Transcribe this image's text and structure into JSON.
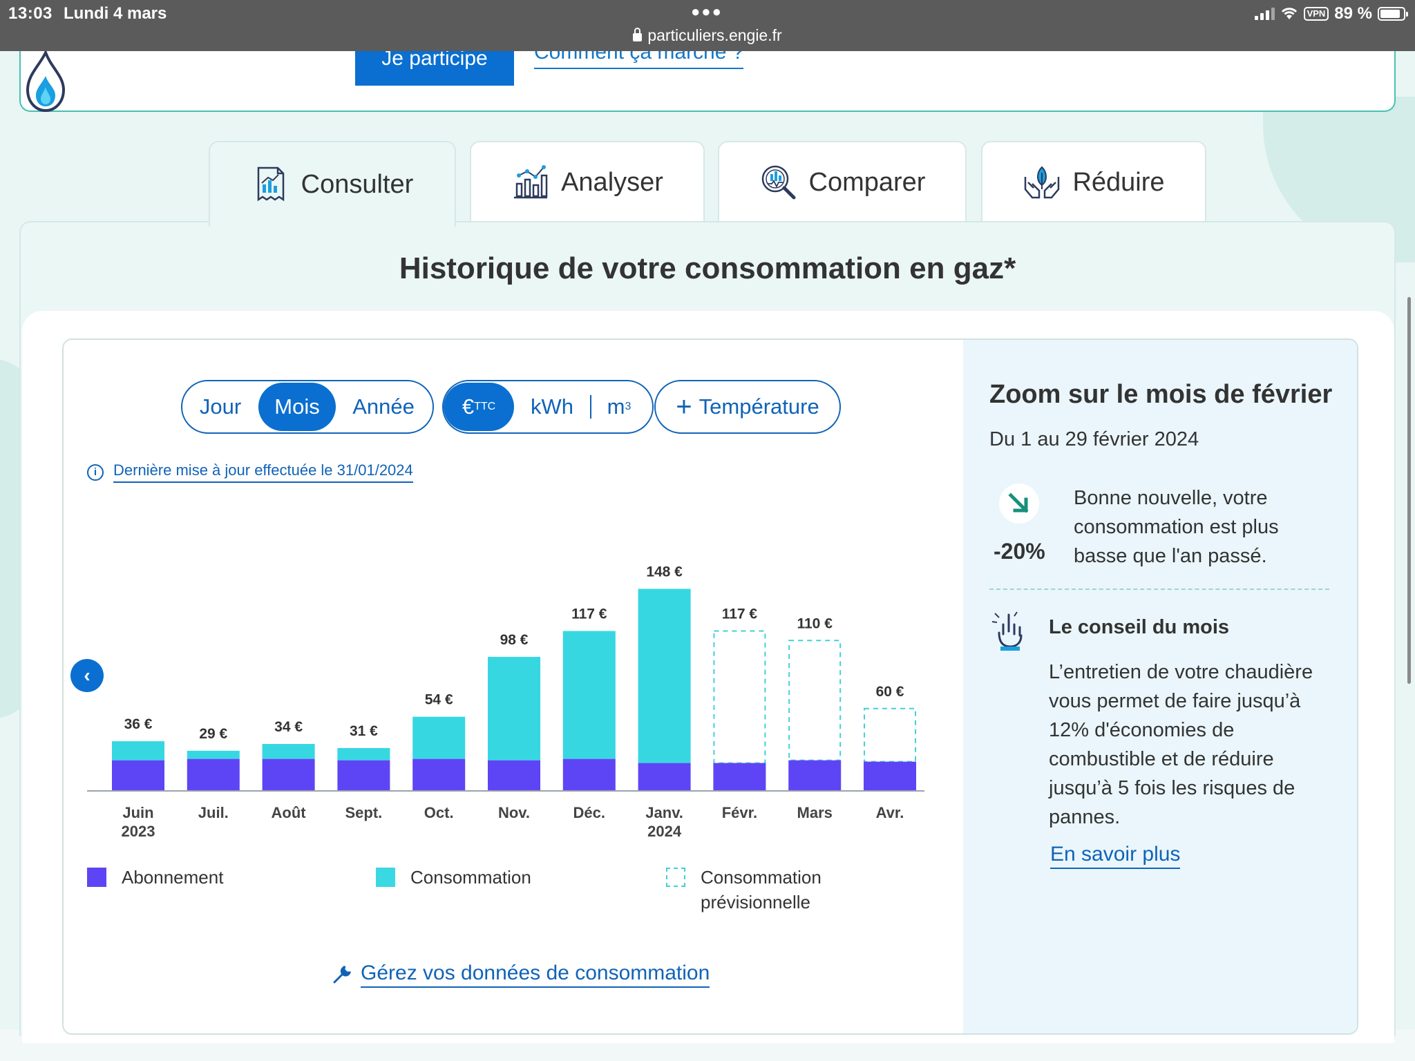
{
  "status_bar": {
    "time": "13:03",
    "date": "Lundi 4 mars",
    "url": "particuliers.engie.fr",
    "vpn": "VPN",
    "battery": "89 %"
  },
  "top": {
    "participe_label": "Je participe",
    "comment_label": "Comment ça marche ?"
  },
  "tabs": [
    {
      "label": "Consulter",
      "icon": "document-chart-icon"
    },
    {
      "label": "Analyser",
      "icon": "bar-trend-icon"
    },
    {
      "label": "Comparer",
      "icon": "magnifier-chart-icon"
    },
    {
      "label": "Réduire",
      "icon": "hands-leaf-icon"
    }
  ],
  "title": "Historique de votre consommation en gaz*",
  "controls": {
    "period": [
      "Jour",
      "Mois",
      "Année"
    ],
    "period_selected": "Mois",
    "unit_euro": "€",
    "unit_euro_sup": "TTC",
    "unit_kwh": "kWh",
    "unit_m3": "m",
    "unit_m3_sup": "3",
    "unit_selected": "€TTC",
    "temperature": "Température"
  },
  "update_text": "Dernière mise à jour effectuée le 31/01/2024",
  "chart_data": {
    "type": "bar",
    "stacked": true,
    "categories": [
      "Juin",
      "Juil.",
      "Août",
      "Sept.",
      "Oct.",
      "Nov.",
      "Déc.",
      "Janv.",
      "Févr.",
      "Mars",
      "Avr."
    ],
    "year_labels": [
      "2023",
      "",
      "",
      "",
      "",
      "",
      "",
      "2024",
      "",
      "",
      ""
    ],
    "value_labels": [
      "36 €",
      "29 €",
      "34 €",
      "31 €",
      "54 €",
      "98 €",
      "117 €",
      "148 €",
      "117 €",
      "110 €",
      "60 €"
    ],
    "totals": [
      36,
      29,
      34,
      31,
      54,
      98,
      117,
      148,
      117,
      110,
      60
    ],
    "series": [
      {
        "name": "Abonnement",
        "color": "#5d45f5",
        "values": [
          22,
          23,
          23,
          22,
          23,
          22,
          23,
          20,
          20,
          22,
          21
        ]
      },
      {
        "name": "Consommation",
        "color": "#37d7e2",
        "values": [
          14,
          6,
          11,
          9,
          31,
          76,
          94,
          128,
          0,
          0,
          0
        ]
      },
      {
        "name": "Consommation prévisionnelle",
        "color": "#3fd1d6",
        "values": [
          0,
          0,
          0,
          0,
          0,
          0,
          0,
          0,
          97,
          88,
          39
        ]
      }
    ],
    "ylim": [
      0,
      148
    ],
    "grid": false
  },
  "legend": {
    "abonnement": "Abonnement",
    "consommation": "Consommation",
    "prev_line1": "Consommation",
    "prev_line2": "prévisionnelle"
  },
  "manage_link": "Gérez vos données de consommation",
  "side": {
    "zoom_title": "Zoom sur le mois de février",
    "zoom_sub": "Du 1 au 29 février 2024",
    "percent": "-20%",
    "good_news": "Bonne nouvelle, votre consommation est plus basse que l'an passé.",
    "tip_title": "Le conseil du mois",
    "tip_text": "L’entretien de votre chaudière vous permet de faire jusqu’à 12% d'économies de combustible et de réduire jusqu’à 5 fois les risques de pannes.",
    "more": "En savoir plus"
  },
  "colors": {
    "primary": "#0a6fd0",
    "abonnement": "#5d45f5",
    "consommation": "#37d7e2",
    "teal_border": "#47c1b3"
  }
}
